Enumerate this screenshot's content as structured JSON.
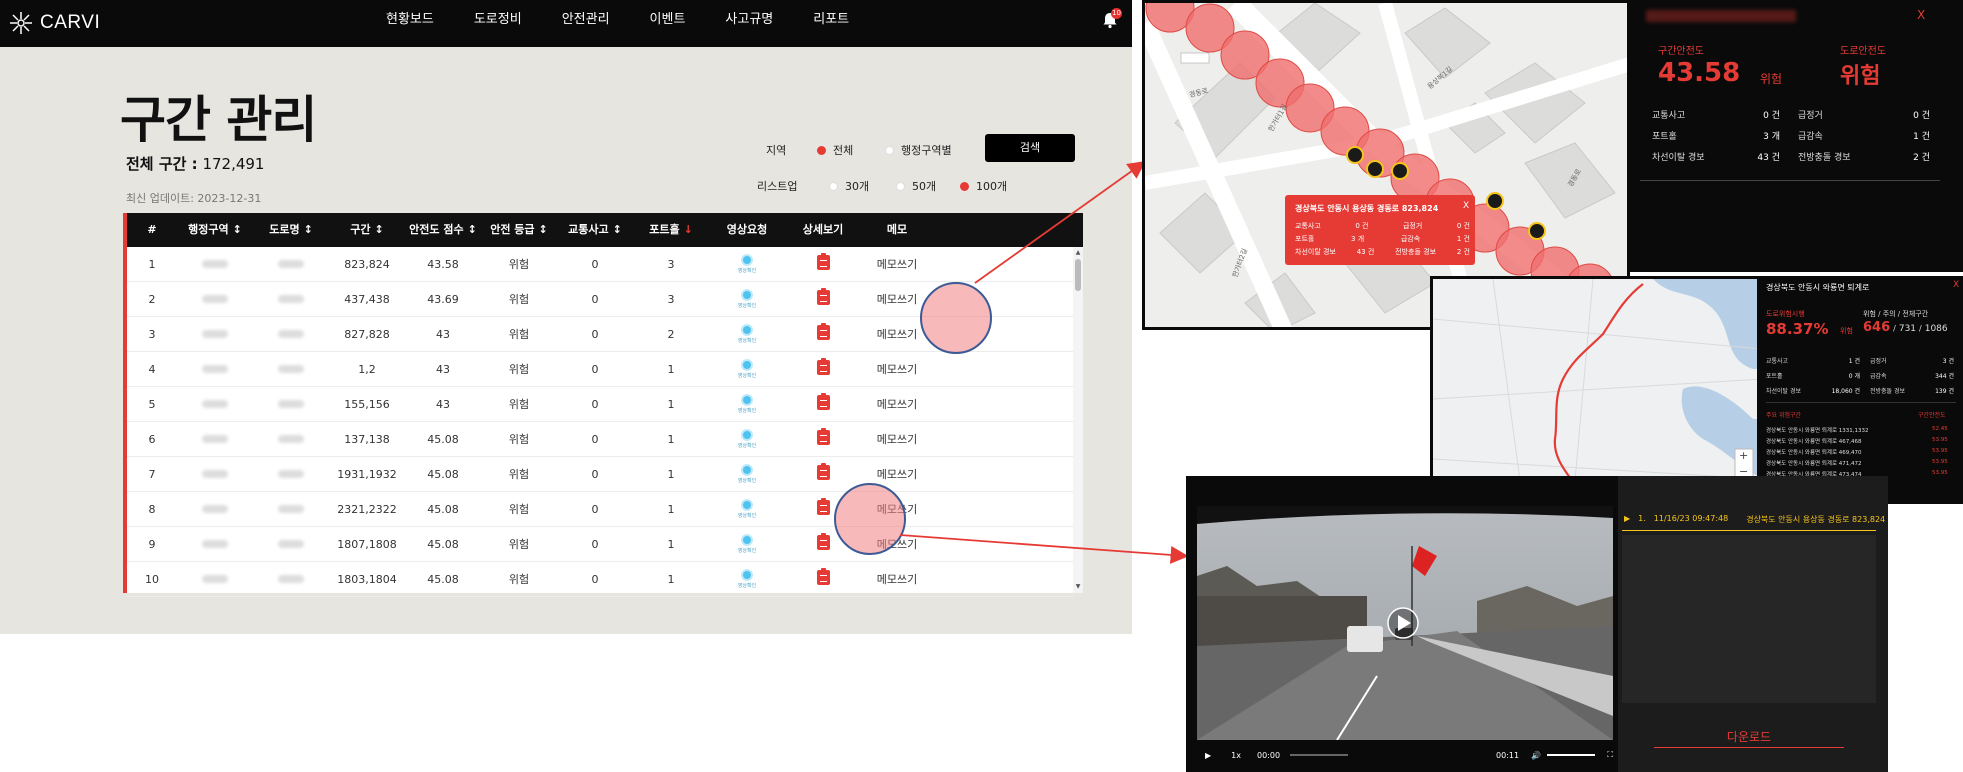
{
  "app": {
    "logo": "CARVI",
    "nav": [
      "현황보드",
      "도로정비",
      "안전관리",
      "이벤트",
      "사고규명",
      "리포트"
    ],
    "notification_count": "10"
  },
  "page": {
    "title": "구간 관리",
    "total_label": "전체 구간 :",
    "total_value": "172,491",
    "updated": "최신 업데이트: 2023-12-31"
  },
  "filters": {
    "region_label": "지역",
    "region_options": [
      {
        "label": "전체",
        "selected": true
      },
      {
        "label": "행정구역별",
        "selected": false
      }
    ],
    "search_label": "검색",
    "list_label": "리스트업",
    "list_options": [
      {
        "label": "30개",
        "selected": false
      },
      {
        "label": "50개",
        "selected": false
      },
      {
        "label": "100개",
        "selected": true
      }
    ]
  },
  "table": {
    "headers": [
      "#",
      "행정구역",
      "도로명",
      "구간",
      "안전도 점수",
      "안전 등급",
      "교통사고",
      "포트홀",
      "영상요청",
      "상세보기",
      "메모"
    ],
    "sort_markers": [
      "",
      "↕",
      "↕",
      "↕",
      "↕",
      "↕",
      "↕",
      "↓",
      "",
      "",
      ""
    ],
    "video_label": "영상확인",
    "memo_label": "메모쓰기",
    "rows": [
      {
        "no": "1",
        "section": "823,824",
        "score": "43.58",
        "grade": "위험",
        "accidents": "0",
        "potholes": "3"
      },
      {
        "no": "2",
        "section": "437,438",
        "score": "43.69",
        "grade": "위험",
        "accidents": "0",
        "potholes": "3"
      },
      {
        "no": "3",
        "section": "827,828",
        "score": "43",
        "grade": "위험",
        "accidents": "0",
        "potholes": "2"
      },
      {
        "no": "4",
        "section": "1,2",
        "score": "43",
        "grade": "위험",
        "accidents": "0",
        "potholes": "1"
      },
      {
        "no": "5",
        "section": "155,156",
        "score": "43",
        "grade": "위험",
        "accidents": "0",
        "potholes": "1"
      },
      {
        "no": "6",
        "section": "137,138",
        "score": "45.08",
        "grade": "위험",
        "accidents": "0",
        "potholes": "1"
      },
      {
        "no": "7",
        "section": "1931,1932",
        "score": "45.08",
        "grade": "위험",
        "accidents": "0",
        "potholes": "1"
      },
      {
        "no": "8",
        "section": "2321,2322",
        "score": "45.08",
        "grade": "위험",
        "accidents": "0",
        "potholes": "1"
      },
      {
        "no": "9",
        "section": "1807,1808",
        "score": "45.08",
        "grade": "위험",
        "accidents": "0",
        "potholes": "1"
      },
      {
        "no": "10",
        "section": "1803,1804",
        "score": "45.08",
        "grade": "위험",
        "accidents": "0",
        "potholes": "1"
      }
    ]
  },
  "section_panel": {
    "safety_label": "구간안전도",
    "safety_value": "43.58",
    "safety_grade": "위험",
    "road_safety_label": "도로안전도",
    "road_safety_value": "위험",
    "close": "X",
    "stats": [
      {
        "label": "교통사고",
        "value": "0 건",
        "label2": "급정거",
        "value2": "0 건"
      },
      {
        "label": "포트홀",
        "value": "3 개",
        "label2": "급감속",
        "value2": "1 건"
      },
      {
        "label": "차선이탈 경보",
        "value": "43 건",
        "label2": "전방충돌 경보",
        "value2": "2 건"
      }
    ]
  },
  "map_popup": {
    "title": "경상북도 안동시 용상동 경동로 823,824",
    "close": "X",
    "stats": [
      {
        "label": "교통사고",
        "value": "0 건",
        "label2": "급정거",
        "value2": "0 건"
      },
      {
        "label": "포트홀",
        "value": "3 개",
        "label2": "급감속",
        "value2": "1 건"
      },
      {
        "label": "차선이탈 경보",
        "value": "43 건",
        "label2": "전방충돌 경보",
        "value2": "2 건"
      }
    ],
    "street_labels": [
      "경동로",
      "한가터1길",
      "용상복1길",
      "한가터2길",
      "경동로"
    ]
  },
  "route_panel": {
    "title": "경상북도 안동시 와룡면 퇴계로",
    "close": "X",
    "risk_label": "도로위험시행",
    "risk_value": "88.37%",
    "risk_grade": "위험",
    "counts_label": "위험 / 주의 / 전체구간",
    "count_danger": "646",
    "count_caution": "731",
    "count_total": "1086",
    "stats": [
      {
        "label": "교통사고",
        "value": "1 건",
        "label2": "급정거",
        "value2": "3 건"
      },
      {
        "label": "포트홀",
        "value": "0 개",
        "label2": "급감속",
        "value2": "344 건"
      },
      {
        "label": "차선이탈 경보",
        "value": "18,060 건",
        "label2": "전방충돌 경보",
        "value2": "139 건"
      }
    ],
    "list_header": "주요 위험구간",
    "list_header2": "구간안전도",
    "list": [
      {
        "name": "경상북도 안동시 와룡면 퇴계로 1331,1332",
        "score": "52.45"
      },
      {
        "name": "경상북도 안동시 와룡면 퇴계로 467,468",
        "score": "53.95"
      },
      {
        "name": "경상북도 안동시 와룡면 퇴계로 469,470",
        "score": "53.95"
      },
      {
        "name": "경상북도 안동시 와룡면 퇴계로 471,472",
        "score": "53.95"
      },
      {
        "name": "경상북도 안동시 와룡면 퇴계로 473,474",
        "score": "53.95"
      }
    ],
    "zoom_in": "+",
    "zoom_out": "−"
  },
  "video_panel": {
    "item_index": "1.",
    "item_time": "11/16/23 09:47:48",
    "item_location": "경상북도 안동시 용상동 경동로 823,824",
    "current_time": "00:00",
    "duration": "00:11",
    "speed": "1x",
    "download": "다운로드"
  },
  "colors": {
    "accent": "#e63b35",
    "header_bg": "#0a0a0a",
    "page_bg": "#e6e5e0"
  }
}
